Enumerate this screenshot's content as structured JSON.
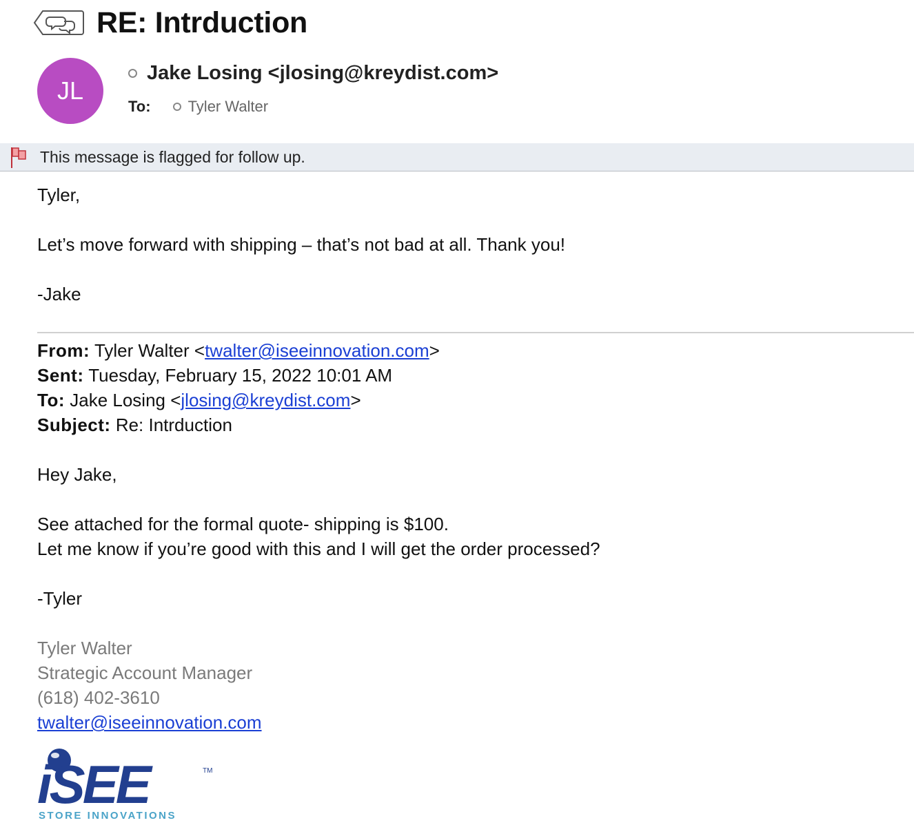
{
  "email": {
    "subject": "RE: Intrduction",
    "avatar_initials": "JL",
    "sender": "Jake Losing <jlosing@kreydist.com>",
    "to_label": "To:",
    "to_name": "Tyler Walter",
    "flag_message": "This message is flagged for follow up.",
    "body": {
      "greeting": "Tyler,",
      "line1": "Let’s move forward with shipping – that’s not bad at all. Thank you!",
      "signoff": "-Jake"
    },
    "quoted": {
      "from_label": "From:",
      "from_name": "Tyler Walter <",
      "from_email": "twalter@iseeinnovation.com",
      "from_close": ">",
      "sent_label": "Sent:",
      "sent_value": "Tuesday, February 15, 2022 10:01 AM",
      "to_label": "To:",
      "to_name": "Jake Losing <",
      "to_email": "jlosing@kreydist.com",
      "to_close": ">",
      "subject_label": "Subject:",
      "subject_value": "Re: Intrduction",
      "greeting": "Hey Jake,",
      "line1": "See attached for the formal quote- shipping is $100.",
      "line2": "Let me know if you’re good with this and I will get the order processed?",
      "signoff": "-Tyler"
    },
    "signature": {
      "name": "Tyler Walter",
      "title": "Strategic Account Manager",
      "phone": "(618) 402-3610",
      "email": "twalter@iseeinnovation.com"
    },
    "logo": {
      "brand": "iSEE",
      "tm": "TM",
      "tagline": "STORE INNOVATIONS"
    }
  },
  "colors": {
    "avatar": "#b84cc2",
    "link": "#1a3fd4",
    "logo_blue": "#223f8f",
    "logo_tagline": "#4aa3c8",
    "flag_red": "#e0454b"
  }
}
